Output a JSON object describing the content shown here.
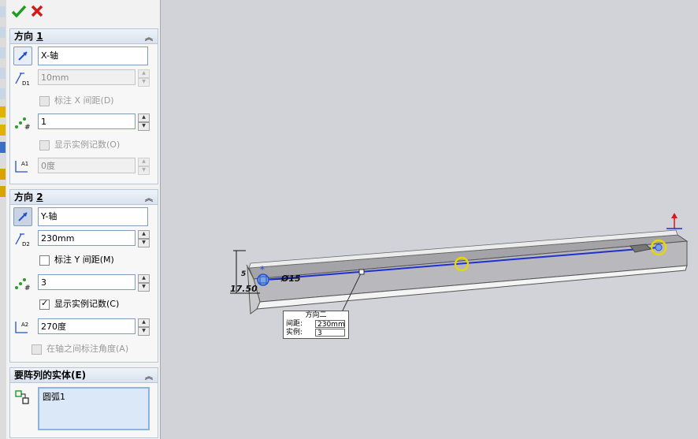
{
  "toolbar": {
    "ok_icon": "checkmark-icon",
    "cancel_icon": "cross-icon"
  },
  "direction1": {
    "header": "方向",
    "header_num": "1",
    "axis_value": "X-轴",
    "spacing_value": "10mm",
    "dim_spacing_label": "标注 X 间距(D)",
    "instances_value": "1",
    "show_count_label": "显示实例记数(O)",
    "angle_value": "0度",
    "icon_labels": {
      "spacing": "D1",
      "angle": "A1"
    }
  },
  "direction2": {
    "header": "方向",
    "header_num": "2",
    "axis_value": "Y-轴",
    "spacing_value": "230mm",
    "dim_spacing_label": "标注 Y 间距(M)",
    "instances_value": "3",
    "show_count_label": "显示实例记数(C)",
    "show_count_checked": true,
    "angle_value": "270度",
    "angle_between_label": "在轴之间标注角度(A)",
    "icon_labels": {
      "spacing": "D2",
      "angle": "A2"
    }
  },
  "bodies": {
    "header": "要阵列的实体(E)",
    "items": [
      "圆弧1"
    ]
  },
  "viewport": {
    "callout": {
      "title": "方向二",
      "spacing_label": "间距:",
      "spacing_value": "230mm",
      "instances_label": "实例:",
      "instances_value": "3"
    },
    "dim_diameter": "Ø15",
    "dim_offset": "17.50",
    "dim_small": "5"
  },
  "colors": {
    "accent": "#1f4fd1",
    "highlight": "#e6d800",
    "header_bg": "#dce5f0"
  }
}
